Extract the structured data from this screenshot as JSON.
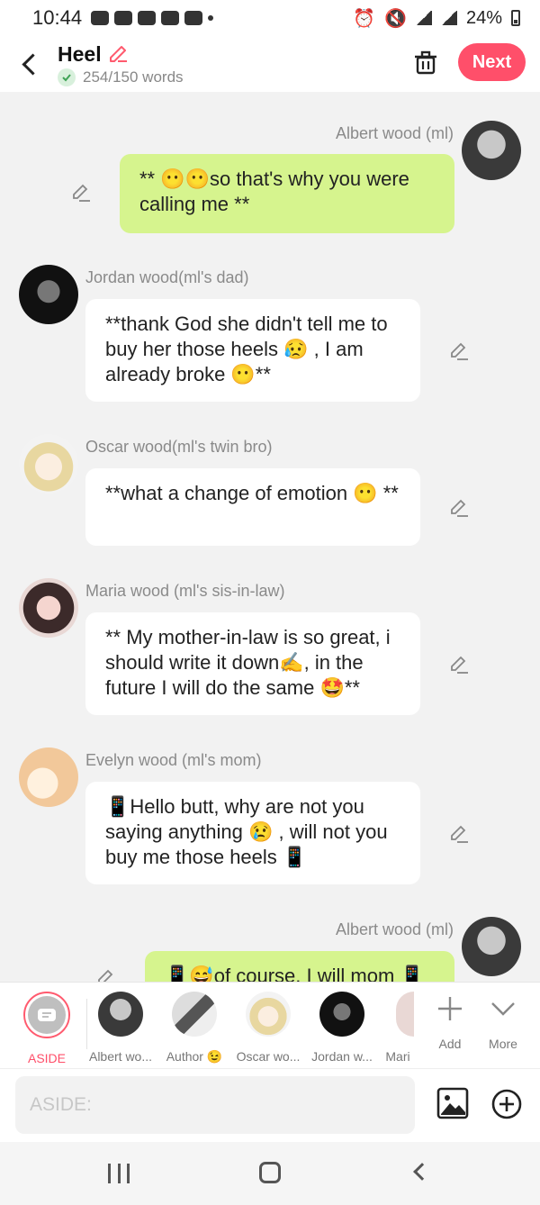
{
  "status_bar": {
    "time": "10:44",
    "battery": "24%"
  },
  "header": {
    "title": "Heel",
    "word_count": "254/150 words",
    "next_label": "Next"
  },
  "messages": [
    {
      "sender": "Albert wood (ml)",
      "text": "** 😶😶so that's why you were calling me **"
    },
    {
      "sender": "Jordan wood(ml's dad)",
      "text": "**thank God she didn't tell me to buy her those heels 😥 , I am already broke 😶**"
    },
    {
      "sender": "Oscar wood(ml's twin bro)",
      "text": "**what a change of emotion 😶 **"
    },
    {
      "sender": "Maria wood (ml's sis-in-law)",
      "text": "** My mother-in-law is so great, i should write it down✍️, in the future I will do the same 🤩**"
    },
    {
      "sender": "Evelyn wood (ml's mom)",
      "text": "📱Hello butt, why are not you saying anything 😢 , will not you buy me those heels 📱"
    },
    {
      "sender": "Albert wood (ml)",
      "text": "📱😅of course, I will mom 📱"
    }
  ],
  "picker": {
    "aside": "ASIDE",
    "characters": [
      "Albert wo...",
      "Author 😉",
      "Oscar wo...",
      "Jordan w...",
      "Mari"
    ],
    "add": "Add",
    "more": "More"
  },
  "input": {
    "placeholder": "ASIDE:"
  },
  "colors": {
    "accent": "#ff4f6a",
    "my_bubble": "#d6f48e",
    "their_bubble": "#ffffff",
    "background": "#f2f2f2"
  }
}
